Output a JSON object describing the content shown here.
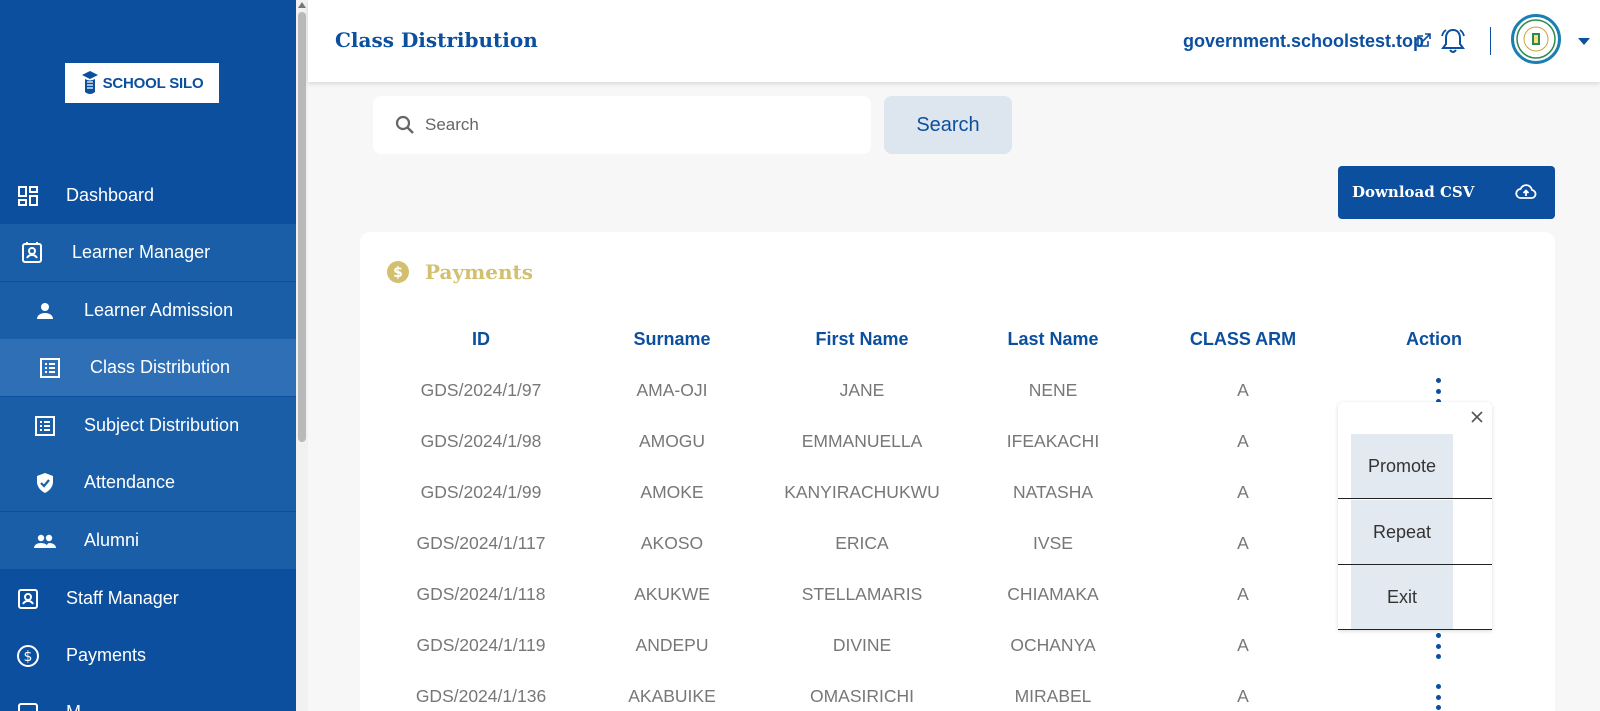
{
  "brand": {
    "logo_text": "SCHOOL SILO"
  },
  "sidebar": {
    "items": [
      {
        "label": "Dashboard",
        "icon": "dashboard-icon"
      },
      {
        "label": "Learner Manager",
        "icon": "id-card-icon"
      },
      {
        "label": "Learner Admission",
        "icon": "person-icon"
      },
      {
        "label": "Class Distribution",
        "icon": "list-icon",
        "active": true
      },
      {
        "label": "Subject Distribution",
        "icon": "list-icon"
      },
      {
        "label": "Attendance",
        "icon": "shield-check-icon"
      },
      {
        "label": "Alumni",
        "icon": "group-icon"
      },
      {
        "label": "Staff Manager",
        "icon": "id-card-icon"
      },
      {
        "label": "Payments",
        "icon": "dollar-icon"
      },
      {
        "label": "M",
        "icon": "id-card-icon"
      }
    ]
  },
  "header": {
    "title": "Class Distribution",
    "domain": "government.schoolstest.top"
  },
  "search": {
    "placeholder": "Search",
    "button_label": "Search"
  },
  "download": {
    "label": "Download CSV"
  },
  "card": {
    "title": "Payments",
    "columns": [
      "ID",
      "Surname",
      "First Name",
      "Last Name",
      "CLASS ARM",
      "Action"
    ],
    "rows": [
      [
        "GDS/2024/1/97",
        "AMA-OJI",
        "JANE",
        "NENE",
        "A"
      ],
      [
        "GDS/2024/1/98",
        "AMOGU",
        "EMMANUELLA",
        "IFEAKACHI",
        "A"
      ],
      [
        "GDS/2024/1/99",
        "AMOKE",
        "KANYIRACHUKWU",
        "NATASHA",
        "A"
      ],
      [
        "GDS/2024/1/117",
        "AKOSO",
        "ERICA",
        "IVSE",
        "A"
      ],
      [
        "GDS/2024/1/118",
        "AKUKWE",
        "STELLAMARIS",
        "CHIAMAKA",
        "A"
      ],
      [
        "GDS/2024/1/119",
        "ANDEPU",
        "DIVINE",
        "OCHANYA",
        "A"
      ],
      [
        "GDS/2024/1/136",
        "AKABUIKE",
        "OMASIRICHI",
        "MIRABEL",
        "A"
      ]
    ]
  },
  "popup_menu": {
    "items": [
      "Promote",
      "Repeat",
      "Exit"
    ]
  },
  "colors": {
    "primary": "#0b4f9e",
    "accent_gold": "#d2c06e"
  }
}
